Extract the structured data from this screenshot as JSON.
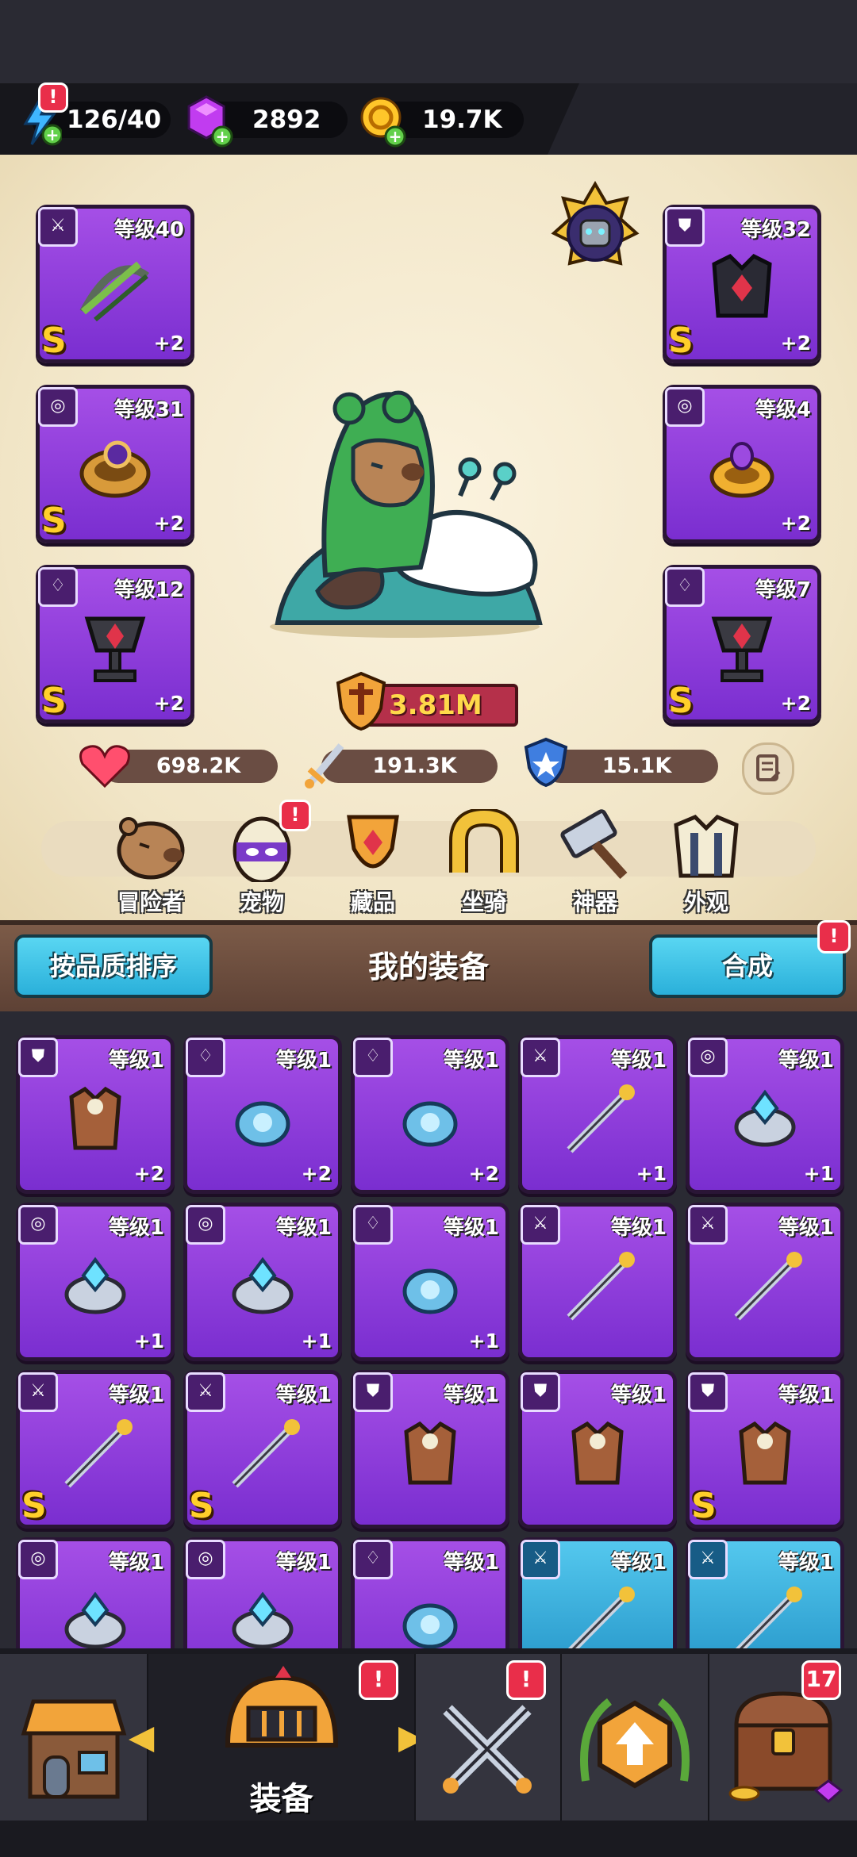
{
  "resources": {
    "energy": "126/40",
    "gems": "2892",
    "gold": "19.7K"
  },
  "hero": {
    "power": "3.81M",
    "health": "698.2K",
    "attack": "191.3K",
    "defense": "15.1K"
  },
  "equipped": [
    {
      "slot": "weapon",
      "level": "等级40",
      "plus": "+2",
      "grade": "S",
      "icon": "sword-icon"
    },
    {
      "slot": "armor",
      "level": "等级32",
      "plus": "+2",
      "grade": "S",
      "icon": "armor-icon"
    },
    {
      "slot": "ring",
      "level": "等级31",
      "plus": "+2",
      "grade": "S",
      "icon": "ring-icon"
    },
    {
      "slot": "ring",
      "level": "等级4",
      "plus": "+2",
      "grade": "",
      "icon": "ring-icon"
    },
    {
      "slot": "necklace",
      "level": "等级12",
      "plus": "+2",
      "grade": "S",
      "icon": "necklace-icon"
    },
    {
      "slot": "necklace",
      "level": "等级7",
      "plus": "+2",
      "grade": "S",
      "icon": "necklace-icon"
    }
  ],
  "menu": [
    {
      "label": "冒险者",
      "notify": false
    },
    {
      "label": "宠物",
      "notify": true
    },
    {
      "label": "藏品",
      "notify": false
    },
    {
      "label": "坐骑",
      "notify": false
    },
    {
      "label": "神器",
      "notify": false
    },
    {
      "label": "外观",
      "notify": false
    }
  ],
  "section": {
    "sort_label": "按品质排序",
    "title": "我的装备",
    "merge_label": "合成"
  },
  "inventory": [
    {
      "level": "等级1",
      "plus": "+2",
      "grade": "",
      "icon": "armor-icon",
      "rarity": "purple"
    },
    {
      "level": "等级1",
      "plus": "+2",
      "grade": "",
      "icon": "necklace-icon",
      "rarity": "purple"
    },
    {
      "level": "等级1",
      "plus": "+2",
      "grade": "",
      "icon": "necklace-icon",
      "rarity": "purple"
    },
    {
      "level": "等级1",
      "plus": "+1",
      "grade": "",
      "icon": "sword-icon",
      "rarity": "purple"
    },
    {
      "level": "等级1",
      "plus": "+1",
      "grade": "",
      "icon": "ring-icon",
      "rarity": "purple"
    },
    {
      "level": "等级1",
      "plus": "+1",
      "grade": "",
      "icon": "ring-icon",
      "rarity": "purple"
    },
    {
      "level": "等级1",
      "plus": "+1",
      "grade": "",
      "icon": "ring-icon",
      "rarity": "purple"
    },
    {
      "level": "等级1",
      "plus": "+1",
      "grade": "",
      "icon": "necklace-icon",
      "rarity": "purple"
    },
    {
      "level": "等级1",
      "plus": "",
      "grade": "",
      "icon": "sword-icon",
      "rarity": "purple"
    },
    {
      "level": "等级1",
      "plus": "",
      "grade": "",
      "icon": "sword-icon",
      "rarity": "purple"
    },
    {
      "level": "等级1",
      "plus": "",
      "grade": "S",
      "icon": "sword-icon",
      "rarity": "purple"
    },
    {
      "level": "等级1",
      "plus": "",
      "grade": "S",
      "icon": "sword-icon",
      "rarity": "purple"
    },
    {
      "level": "等级1",
      "plus": "",
      "grade": "",
      "icon": "armor-icon",
      "rarity": "purple"
    },
    {
      "level": "等级1",
      "plus": "",
      "grade": "",
      "icon": "armor-icon",
      "rarity": "purple"
    },
    {
      "level": "等级1",
      "plus": "",
      "grade": "S",
      "icon": "armor-icon",
      "rarity": "purple"
    },
    {
      "level": "等级1",
      "plus": "",
      "grade": "",
      "icon": "ring-icon",
      "rarity": "purple"
    },
    {
      "level": "等级1",
      "plus": "",
      "grade": "",
      "icon": "ring-icon",
      "rarity": "purple"
    },
    {
      "level": "等级1",
      "plus": "",
      "grade": "",
      "icon": "necklace-icon",
      "rarity": "purple"
    },
    {
      "level": "等级1",
      "plus": "",
      "grade": "",
      "icon": "sword-icon",
      "rarity": "blue"
    },
    {
      "level": "等级1",
      "plus": "",
      "grade": "",
      "icon": "sword-icon",
      "rarity": "blue"
    }
  ],
  "bottom_nav": {
    "shop": {
      "label": "",
      "notify": false
    },
    "equipment": {
      "label": "装备",
      "notify": true
    },
    "battle": {
      "label": "",
      "notify": true
    },
    "upgrade": {
      "label": "",
      "notify": false
    },
    "chest": {
      "label": "",
      "badge": "17"
    }
  },
  "colors": {
    "epic_purple": "#8b3ee0",
    "rare_blue": "#2aa6d8",
    "accent_cyan": "#3fc4e8",
    "alert_red": "#e92e4a",
    "grade_gold": "#ffcf2a"
  }
}
